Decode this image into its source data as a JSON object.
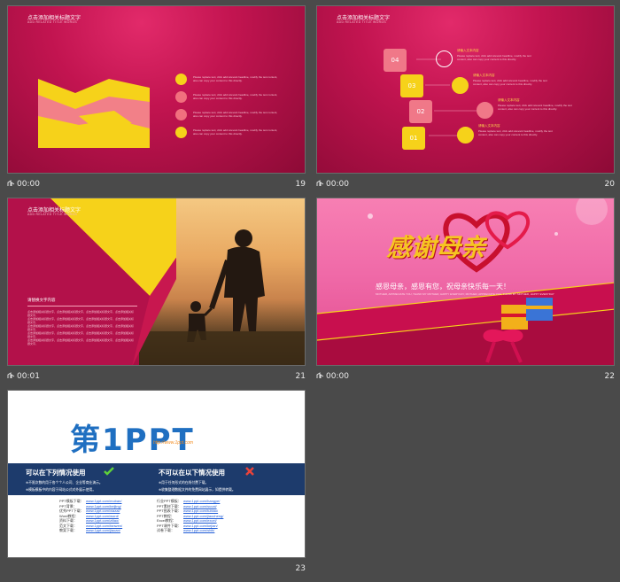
{
  "slides": [
    {
      "number": "19",
      "time": "00:00",
      "title": "点击添加相关标题文字",
      "subtitle": "ADD RELATED TITLE WORDS",
      "body_text": "Please replace text, click add relevant headline, modify the text content, also can copy your content to this directly.",
      "icons": [
        "bulb-icon",
        "tag-icon",
        "phone-icon",
        "cup-icon"
      ]
    },
    {
      "number": "20",
      "time": "00:00",
      "title": "点击添加相关标题文字",
      "subtitle": "ADD RELATED TITLE WORDS",
      "steps": [
        {
          "n": "04",
          "heading": "请输入文本内容",
          "icon": "gear-icon"
        },
        {
          "n": "03",
          "heading": "请输入文本内容",
          "icon": "pencil-icon"
        },
        {
          "n": "02",
          "heading": "请输入文本内容",
          "icon": "heart-icon"
        },
        {
          "n": "01",
          "heading": "请输入文本内容",
          "icon": "screen-icon"
        }
      ],
      "step_text": "Please replace text, click add relevant headline, modify the text content, also can copy your content to this directly."
    },
    {
      "number": "21",
      "time": "00:01",
      "title": "点击添加相关标题文字",
      "subtitle": "ADD RELATED TITLE WORDS",
      "section_label": "请替换文字内容",
      "body_line": "点击添加相关标题文字，点击添加相关标题文字，点击添加相关标题文字，点击添加相关标题文字，"
    },
    {
      "number": "22",
      "time": "00:00",
      "headline": "感谢母亲",
      "tagline": "感恩母亲，感恩有您，祝母亲快乐每一天！",
      "tagline_en": "MOTHER, APPRECIATE YOU, THANK MY MOTHER, HAPPY EVERYDAY; MOTHER, APPRECIATE YOU, THANK MY MOTHER, HAPPY EVERYDAY"
    },
    {
      "number": "23",
      "time": "",
      "logo_text": "第1PPT",
      "logo_url": "http://www.1ppt.com",
      "can_use_title": "可以在下列情况使用",
      "can_use_lines": [
        "※不限次数的用于各个个人公司、企业等商业演示。",
        "※模板模板中的内容于网站公式对外展示使用。"
      ],
      "cannot_use_title": "不可以在以下情况使用",
      "cannot_use_lines": [
        "※用于任何形式的在线付费下载。",
        "※收集整理数据文件的免费网站展示，如提供转载。"
      ],
      "links_left": [
        {
          "label": "PPT模板下载：",
          "url": "www.1ppt.com/moban/"
        },
        {
          "label": "PPT背景：",
          "url": "www.1ppt.com/beijing/"
        },
        {
          "label": "优秀PPT下载：",
          "url": "www.1ppt.com/xiazai/"
        },
        {
          "label": "Word教程：",
          "url": "www.1ppt.com/word/"
        },
        {
          "label": "资料下载：",
          "url": "www.1ppt.com/ziliao/"
        },
        {
          "label": "范文下载：",
          "url": "www.1ppt.com/fanwen/"
        },
        {
          "label": "教案下载：",
          "url": "www.1ppt.com/jiaoan/"
        }
      ],
      "links_right": [
        {
          "label": "行业PPT模板：",
          "url": "www.1ppt.com/hangye/"
        },
        {
          "label": "PPT素材下载：",
          "url": "www.1ppt.com/sucai/"
        },
        {
          "label": "PPT图表下载：",
          "url": "www.1ppt.com/tubiao/"
        },
        {
          "label": "PPT教程：",
          "url": "www.1ppt.com/jiaocheng/"
        },
        {
          "label": "Excel教程：",
          "url": "www.1ppt.com/excel/"
        },
        {
          "label": "PPT课件下载：",
          "url": "www.1ppt.com/kejian/"
        },
        {
          "label": "试卷下载：",
          "url": "www.1ppt.com/shiti/"
        }
      ]
    }
  ]
}
